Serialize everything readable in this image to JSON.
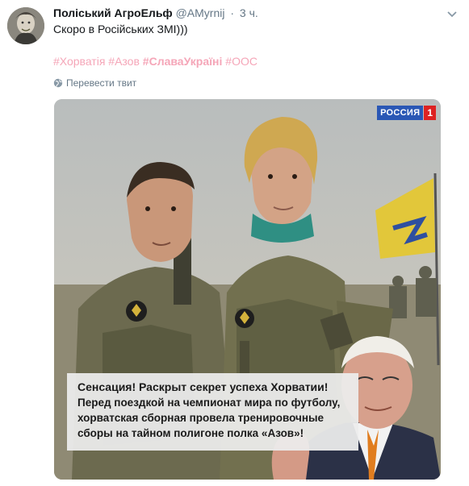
{
  "tweet": {
    "author_name": "Поліський АгроЕльф",
    "author_handle": "@AMyrnij",
    "separator": "·",
    "time": "3 ч.",
    "text": "Скоро в Російських ЗМІ)))",
    "hashtags": [
      {
        "text": "#Хорватія",
        "bold": false
      },
      {
        "text": "#Азов",
        "bold": false
      },
      {
        "text": "#СлаваУкраїні",
        "bold": true
      },
      {
        "text": "#ООС",
        "bold": false
      }
    ],
    "translate_label": "Перевести твит"
  },
  "media": {
    "channel_logo_text": "РОССИЯ",
    "channel_logo_number": "1",
    "caption_headline": "Сенсация! Раскрыт секрет успеха Хорватии!",
    "caption_lines": [
      "Перед поездкой на чемпионат мира по футболу,",
      "хорватская сборная провела тренировочные",
      "сборы на тайном полигоне полка «Азов»!"
    ]
  },
  "colors": {
    "hashtag": "#f5a6b8",
    "secondary_text": "#657786",
    "channel_blue": "#2a57b5",
    "channel_red": "#dd2222"
  },
  "icons": [
    "avatar",
    "caret-down-icon",
    "globe-icon"
  ]
}
